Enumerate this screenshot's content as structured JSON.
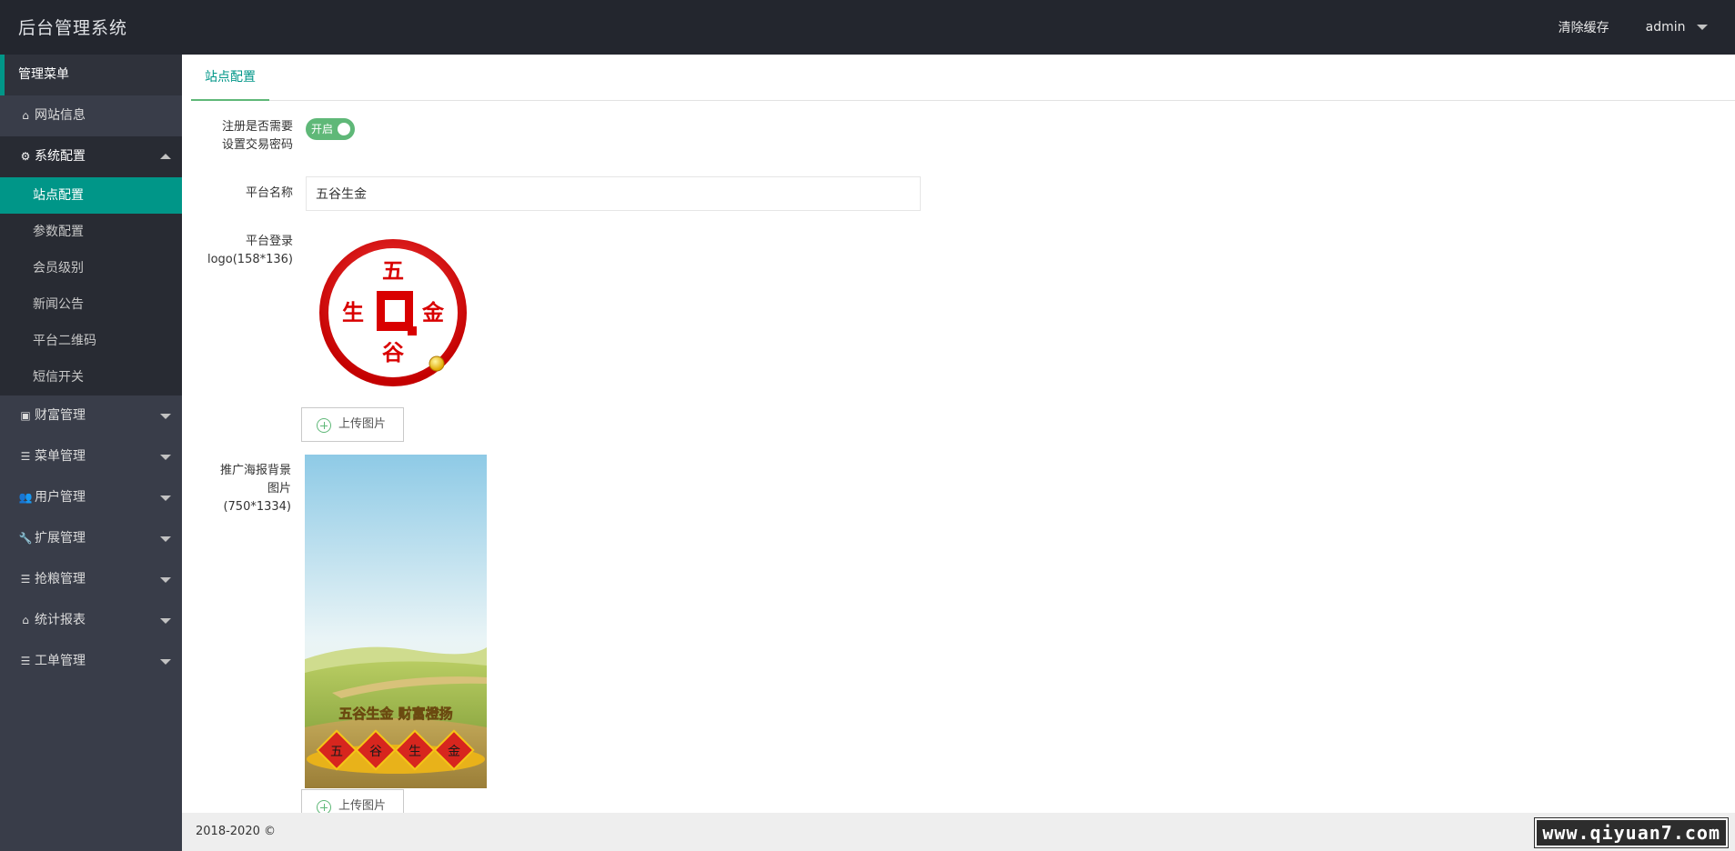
{
  "header": {
    "title": "后台管理系统",
    "clear_cache": "清除缓存",
    "user": "admin"
  },
  "sidebar": {
    "menu_title": "管理菜单",
    "items": [
      {
        "label": "网站信息",
        "icon": "home-icon"
      },
      {
        "label": "系统配置",
        "icon": "gears-icon"
      },
      {
        "label": "财富管理",
        "icon": "money-icon"
      },
      {
        "label": "菜单管理",
        "icon": "bars-icon"
      },
      {
        "label": "用户管理",
        "icon": "users-icon"
      },
      {
        "label": "扩展管理",
        "icon": "wrench-icon"
      },
      {
        "label": "抢粮管理",
        "icon": "bars-icon"
      },
      {
        "label": "统计报表",
        "icon": "home-icon"
      },
      {
        "label": "工单管理",
        "icon": "bars-icon"
      }
    ],
    "submenu": [
      "站点配置",
      "参数配置",
      "会员级别",
      "新闻公告",
      "平台二维码",
      "短信开关"
    ]
  },
  "tabs": [
    "站点配置"
  ],
  "form": {
    "register_pwd_label_1": "注册是否需要",
    "register_pwd_label_2": "设置交易密码",
    "switch_text": "开启",
    "platform_name_label": "平台名称",
    "platform_name_value": "五谷生金",
    "login_logo_label_1": "平台登录",
    "login_logo_label_2": "logo(158*136)",
    "logo_chars": {
      "top": "五",
      "left": "生",
      "right": "金",
      "bottom": "谷"
    },
    "upload_label": "上传图片",
    "poster_label_1": "推广海报背景",
    "poster_label_2": "图片",
    "poster_label_3": "(750*1334)",
    "poster_slogan": "五谷生金  财富橙扬",
    "poster_tiles": [
      "五",
      "谷",
      "生",
      "金"
    ]
  },
  "footer": {
    "copyright": "2018-2020 ©"
  },
  "watermark": "www.qiyuan7.com",
  "colors": {
    "header_bg": "#23262e",
    "sidebar_bg": "#393d49",
    "accent": "#009688",
    "switch_on": "#5fb878"
  }
}
